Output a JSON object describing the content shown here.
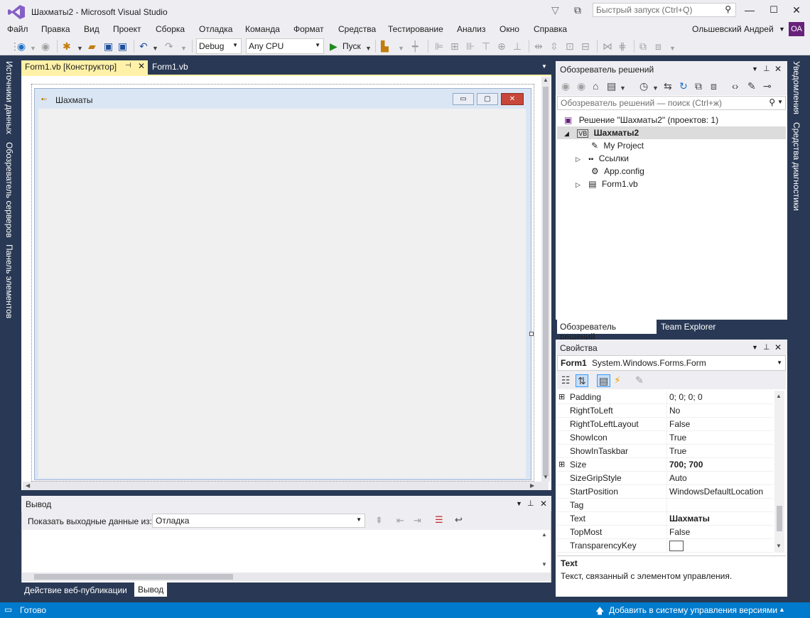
{
  "window": {
    "title": "Шахматы2 - Microsoft Visual Studio",
    "quick_launch_placeholder": "Быстрый запуск (Ctrl+Q)"
  },
  "menu": [
    "Файл",
    "Правка",
    "Вид",
    "Проект",
    "Сборка",
    "Отладка",
    "Команда",
    "Формат",
    "Средства",
    "Тестирование",
    "Анализ",
    "Окно",
    "Справка"
  ],
  "account": {
    "name": "Ольшевский Андрей",
    "initials": "ОА"
  },
  "toolbar": {
    "configuration": "Debug",
    "platform": "Any CPU",
    "run_label": "Пуск"
  },
  "left_tabs": [
    "Источники данных",
    "Обозреватель серверов",
    "Панель элементов"
  ],
  "right_tabs": [
    "Уведомления",
    "Средства диагностики"
  ],
  "doc_tabs": [
    {
      "label": "Form1.vb [Конструктор]",
      "active": true
    },
    {
      "label": "Form1.vb",
      "active": false
    }
  ],
  "designer": {
    "form_title": "Шахматы"
  },
  "output": {
    "title": "Вывод",
    "show_from_label": "Показать выходные данные из:",
    "source": "Отладка",
    "tabs": [
      "Действие веб-публикации",
      "Вывод"
    ]
  },
  "solution_explorer": {
    "title": "Обозреватель решений",
    "search_placeholder": "Обозреватель решений — поиск (Ctrl+ж)",
    "tree": [
      {
        "label": "Решение \"Шахматы2\"  (проектов: 1)"
      },
      {
        "label": "Шахматы2"
      },
      {
        "label": "My Project"
      },
      {
        "label": "Ссылки"
      },
      {
        "label": "App.config"
      },
      {
        "label": "Form1.vb"
      }
    ],
    "tabs": [
      "Обозреватель решений",
      "Team Explorer"
    ]
  },
  "properties": {
    "title": "Свойства",
    "object_name": "Form1",
    "object_type": "System.Windows.Forms.Form",
    "rows": [
      {
        "name": "Padding",
        "value": "0; 0; 0; 0"
      },
      {
        "name": "RightToLeft",
        "value": "No"
      },
      {
        "name": "RightToLeftLayout",
        "value": "False"
      },
      {
        "name": "ShowIcon",
        "value": "True"
      },
      {
        "name": "ShowInTaskbar",
        "value": "True"
      },
      {
        "name": "Size",
        "value": "700; 700"
      },
      {
        "name": "SizeGripStyle",
        "value": "Auto"
      },
      {
        "name": "StartPosition",
        "value": "WindowsDefaultLocation"
      },
      {
        "name": "Tag",
        "value": ""
      },
      {
        "name": "Text",
        "value": "Шахматы"
      },
      {
        "name": "TopMost",
        "value": "False"
      },
      {
        "name": "TransparencyKey",
        "value": ""
      }
    ],
    "description_title": "Text",
    "description_text": "Текст, связанный с элементом управления."
  },
  "status": {
    "text": "Готово",
    "vc_label": "Добавить в систему управления версиями"
  },
  "colors": {
    "accent": "#007acc",
    "chrome": "#eeeef2",
    "background": "#293955",
    "active_tab": "#fff1a8",
    "vs_purple": "#68217a"
  }
}
